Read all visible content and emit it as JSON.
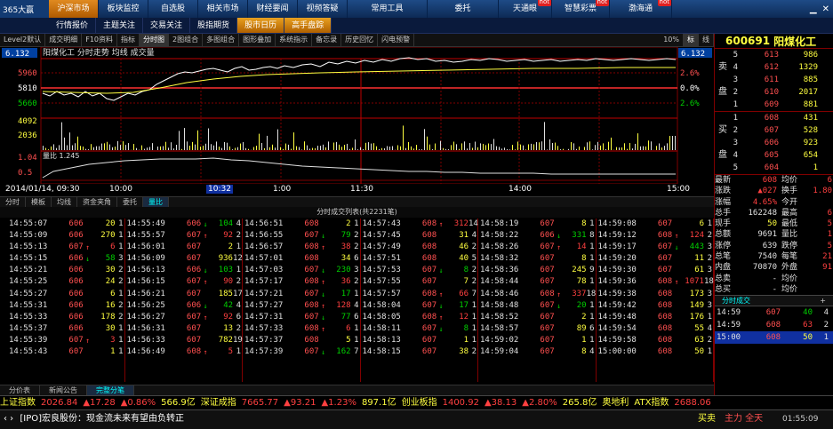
{
  "topnav": {
    "logo": "365大赢",
    "items": [
      {
        "label": "沪深市场",
        "active": true
      },
      {
        "label": "板块监控"
      },
      {
        "label": "自选股"
      },
      {
        "label": "相关市场"
      },
      {
        "label": "财经要闻"
      },
      {
        "label": "视频答疑"
      },
      {
        "label": "常用工具"
      },
      {
        "label": "委托"
      },
      {
        "label": "天通眼",
        "hot": "hot"
      },
      {
        "label": "智慧彩票",
        "hot": "hot"
      },
      {
        "label": "渤海通",
        "hot": "hot"
      }
    ]
  },
  "row2": [
    {
      "label": "行情报价"
    },
    {
      "label": "主题关注"
    },
    {
      "label": "交易关注"
    },
    {
      "label": "股指期货"
    },
    {
      "label": "股市日历",
      "active": true
    },
    {
      "label": "高手盘踪",
      "active": true
    }
  ],
  "toolbar": [
    "Level2默认",
    "成交明细",
    "F10资料",
    "指标",
    "分时图",
    "2图组合",
    "多图组合",
    "图形叠加",
    "系统指示",
    "备忘录",
    "历史回忆",
    "闪电预警",
    "10%",
    "标",
    "线"
  ],
  "chart": {
    "price_top": "6.132",
    "price_top_right": "6.132",
    "title": "阳煤化工 分时走势  均线  成交量",
    "y_left": [
      "5960",
      "5810",
      "5660"
    ],
    "y_right": [
      "2.6%",
      "0.0%",
      "2.6%"
    ],
    "vol_left": [
      "4092",
      "2036"
    ],
    "liangbi": "量比 1.245",
    "lb_left": [
      "1.04",
      "0.5"
    ]
  },
  "timeaxis": {
    "date": "2014/01/14, 09:30",
    "t1": "10:00",
    "cursor": "10:32",
    "t2": "1:00",
    "t3": "11:30",
    "t4": "14:00",
    "t5": "15:00"
  },
  "tabrow": [
    "分时",
    "模板",
    "均线",
    "资金夹角",
    "委托",
    "量比"
  ],
  "table_title": "分时成交列表(共2231笔)",
  "trades": [
    [
      [
        "14:55:07",
        "606",
        "",
        "20",
        "1"
      ],
      [
        "14:55:09",
        "606",
        "",
        "270",
        "1"
      ],
      [
        "14:55:13",
        "607",
        "↑",
        "6",
        "1"
      ],
      [
        "14:55:15",
        "606",
        "↓",
        "58",
        "3"
      ],
      [
        "14:55:21",
        "606",
        "",
        "30",
        "2"
      ],
      [
        "14:55:25",
        "606",
        "",
        "24",
        "2"
      ],
      [
        "14:55:27",
        "606",
        "",
        "6",
        "1"
      ],
      [
        "14:55:31",
        "606",
        "",
        "16",
        "2"
      ],
      [
        "14:55:33",
        "606",
        "",
        "178",
        "2"
      ],
      [
        "14:55:37",
        "606",
        "",
        "30",
        "1"
      ],
      [
        "14:55:39",
        "607",
        "↑",
        "3",
        "1"
      ],
      [
        "14:55:43",
        "607",
        "",
        "1",
        "1"
      ]
    ],
    [
      [
        "14:55:49",
        "606",
        "↓",
        "104",
        "4"
      ],
      [
        "14:55:57",
        "607",
        "↑",
        "92",
        "2"
      ],
      [
        "14:56:01",
        "607",
        "",
        "2",
        "1"
      ],
      [
        "14:56:09",
        "607",
        "",
        "936",
        "12"
      ],
      [
        "14:56:13",
        "606",
        "↓",
        "103",
        "1"
      ],
      [
        "14:56:15",
        "607",
        "↑",
        "90",
        "2"
      ],
      [
        "14:56:21",
        "607",
        "",
        "185",
        "17"
      ],
      [
        "14:56:25",
        "606",
        "↓",
        "42",
        "4"
      ],
      [
        "14:56:27",
        "607",
        "↑",
        "92",
        "6"
      ],
      [
        "14:56:31",
        "607",
        "",
        "13",
        "2"
      ],
      [
        "14:56:33",
        "607",
        "",
        "782",
        "19"
      ],
      [
        "14:56:49",
        "608",
        "↑",
        "5",
        "1"
      ]
    ],
    [
      [
        "14:56:51",
        "608",
        "",
        "2",
        "1"
      ],
      [
        "14:56:55",
        "607",
        "↓",
        "79",
        "2"
      ],
      [
        "14:56:57",
        "608",
        "↑",
        "38",
        "2"
      ],
      [
        "14:57:01",
        "608",
        "",
        "34",
        "6"
      ],
      [
        "14:57:03",
        "607",
        "↓",
        "230",
        "3"
      ],
      [
        "14:57:17",
        "608",
        "↑",
        "36",
        "2"
      ],
      [
        "14:57:21",
        "607",
        "↓",
        "17",
        "1"
      ],
      [
        "14:57:27",
        "608",
        "↑",
        "128",
        "4"
      ],
      [
        "14:57:31",
        "607",
        "↓",
        "77",
        "6"
      ],
      [
        "14:57:33",
        "608",
        "↑",
        "6",
        "1"
      ],
      [
        "14:57:37",
        "608",
        "",
        "5",
        "1"
      ],
      [
        "14:57:39",
        "607",
        "↓",
        "162",
        "7"
      ]
    ],
    [
      [
        "14:57:43",
        "608",
        "↑",
        "312",
        "14"
      ],
      [
        "14:57:45",
        "608",
        "",
        "31",
        "4"
      ],
      [
        "14:57:49",
        "608",
        "",
        "46",
        "2"
      ],
      [
        "14:57:51",
        "608",
        "",
        "40",
        "5"
      ],
      [
        "14:57:53",
        "607",
        "↓",
        "8",
        "2"
      ],
      [
        "14:57:55",
        "607",
        "",
        "7",
        "2"
      ],
      [
        "14:57:57",
        "608",
        "↑",
        "66",
        "7"
      ],
      [
        "14:58:04",
        "607",
        "↓",
        "17",
        "1"
      ],
      [
        "14:58:05",
        "608",
        "↑",
        "12",
        "1"
      ],
      [
        "14:58:11",
        "607",
        "↓",
        "8",
        "1"
      ],
      [
        "14:58:13",
        "607",
        "",
        "1",
        "1"
      ],
      [
        "14:58:15",
        "607",
        "",
        "38",
        "2"
      ]
    ],
    [
      [
        "14:58:19",
        "607",
        "",
        "8",
        "1"
      ],
      [
        "14:58:22",
        "606",
        "↓",
        "331",
        "8"
      ],
      [
        "14:58:26",
        "607",
        "↑",
        "14",
        "1"
      ],
      [
        "14:58:32",
        "607",
        "",
        "8",
        "1"
      ],
      [
        "14:58:36",
        "607",
        "",
        "245",
        "9"
      ],
      [
        "14:58:44",
        "607",
        "",
        "78",
        "1"
      ],
      [
        "14:58:46",
        "608",
        "↑",
        "337",
        "18"
      ],
      [
        "14:58:48",
        "607",
        "↓",
        "20",
        "1"
      ],
      [
        "14:58:52",
        "607",
        "",
        "2",
        "1"
      ],
      [
        "14:58:57",
        "607",
        "",
        "89",
        "6"
      ],
      [
        "14:59:02",
        "607",
        "",
        "1",
        "1"
      ],
      [
        "14:59:04",
        "607",
        "",
        "8",
        "4"
      ]
    ],
    [
      [
        "14:59:08",
        "607",
        "",
        "6",
        "1"
      ],
      [
        "14:59:12",
        "608",
        "↑",
        "124",
        "2"
      ],
      [
        "14:59:17",
        "607",
        "↓",
        "443",
        "3"
      ],
      [
        "14:59:20",
        "607",
        "",
        "11",
        "2"
      ],
      [
        "14:59:30",
        "607",
        "",
        "61",
        "3"
      ],
      [
        "14:59:36",
        "608",
        "↑",
        "1071",
        "18"
      ],
      [
        "14:59:38",
        "608",
        "",
        "173",
        "3"
      ],
      [
        "14:59:42",
        "608",
        "",
        "149",
        "3"
      ],
      [
        "14:59:48",
        "608",
        "",
        "176",
        "1"
      ],
      [
        "14:59:54",
        "608",
        "",
        "55",
        "4"
      ],
      [
        "14:59:58",
        "608",
        "",
        "63",
        "2"
      ],
      [
        "15:00:00",
        "608",
        "",
        "50",
        "1"
      ]
    ]
  ],
  "bottom_tabs": [
    "分价表",
    "新闻公告",
    "完整分笔"
  ],
  "indexbar": [
    {
      "text": "上证指数",
      "cls": "wy"
    },
    {
      "text": "2026.84",
      "cls": "up"
    },
    {
      "text": "▲17.28",
      "cls": "up"
    },
    {
      "text": "▲0.86%",
      "cls": "up"
    },
    {
      "text": "566.9亿",
      "cls": "wy"
    },
    {
      "text": "深证成指",
      "cls": "wy"
    },
    {
      "text": "7665.77",
      "cls": "up"
    },
    {
      "text": "▲93.21",
      "cls": "up"
    },
    {
      "text": "▲1.23%",
      "cls": "up"
    },
    {
      "text": "897.1亿",
      "cls": "wy"
    },
    {
      "text": "创业板指",
      "cls": "wy"
    },
    {
      "text": "1400.92",
      "cls": "up"
    },
    {
      "text": "▲38.13",
      "cls": "up"
    },
    {
      "text": "▲2.80%",
      "cls": "up"
    },
    {
      "text": "265.8亿",
      "cls": "wy"
    },
    {
      "text": "奥地利",
      "cls": "wy"
    },
    {
      "text": "ATX指数",
      "cls": "wy"
    },
    {
      "text": "2688.06",
      "cls": "up"
    }
  ],
  "newsbar": {
    "tag": "[IPO]宏良股份：现金流未来有望由负转正",
    "right1": "买卖",
    "right2": "主力 全天",
    "time": "01:55:09"
  },
  "rpanel": {
    "code": "600691",
    "name": "阳煤化工",
    "sell_label": [
      "卖",
      "盘"
    ],
    "buy_label": [
      "买",
      "盘"
    ],
    "sells": [
      [
        "5",
        "613",
        "986"
      ],
      [
        "4",
        "612",
        "1329"
      ],
      [
        "3",
        "611",
        "885"
      ],
      [
        "2",
        "610",
        "2017"
      ],
      [
        "1",
        "609",
        "881"
      ]
    ],
    "buys": [
      [
        "1",
        "608",
        "431"
      ],
      [
        "2",
        "607",
        "528"
      ],
      [
        "3",
        "606",
        "923"
      ],
      [
        "4",
        "605",
        "654"
      ],
      [
        "5",
        "604",
        "1"
      ]
    ],
    "stats": [
      [
        "最新",
        "608",
        "up",
        "均价",
        "6"
      ],
      [
        "涨跌",
        "▲027",
        "up",
        "换手",
        "1.80"
      ],
      [
        "涨幅",
        "4.65%",
        "up",
        "今开",
        ""
      ],
      [
        "总手",
        "162248",
        "wh",
        "最高",
        "6"
      ],
      [
        "现手",
        "50",
        "wy",
        "最低",
        "5"
      ],
      [
        "总额",
        "9691",
        "wh",
        "量比",
        "1"
      ],
      [
        "涨停",
        "639",
        "wh",
        "跌停",
        "5"
      ],
      [
        "总笔",
        "7540",
        "wh",
        "每笔",
        "21"
      ],
      [
        "内盘",
        "70870",
        "wh",
        "外盘",
        "91"
      ],
      [
        "总卖",
        "-",
        "wh",
        "均价",
        ""
      ],
      [
        "总买",
        "-",
        "wh",
        "均价",
        ""
      ]
    ],
    "tabs": [
      "分时成交",
      "+"
    ],
    "last_trades": [
      [
        "14:59",
        "607",
        "↓",
        "40",
        "4",
        false
      ],
      [
        "14:59",
        "608",
        "↑",
        "63",
        "2",
        false
      ],
      [
        "15:00",
        "608",
        "",
        "50",
        "1",
        true
      ]
    ]
  }
}
